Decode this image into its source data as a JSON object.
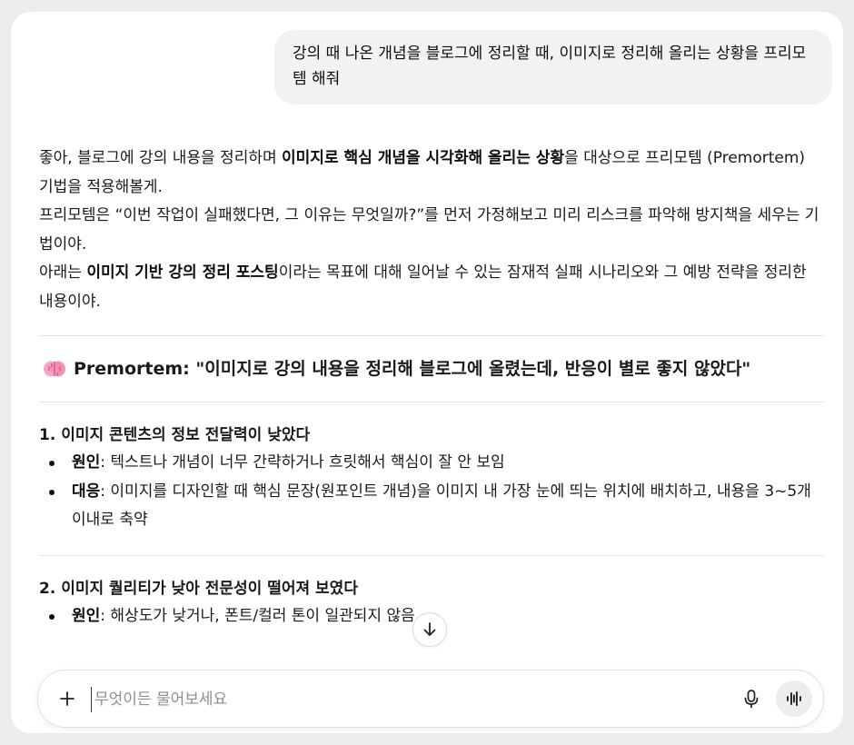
{
  "user_message": "강의 때 나온 개념을 블로그에 정리할 때, 이미지로 정리해 올리는 상황을 프리모템 해줘",
  "answer": {
    "intro": {
      "p1_a": "좋아, 블로그에 강의 내용을 정리하며 ",
      "p1_bold": "이미지로 핵심 개념을 시각화해 올리는 상황",
      "p1_b": "을 대상으로 프리모템 (Premortem) 기법을 적용해볼게.",
      "p2": "프리모템은 “이번 작업이 실패했다면, 그 이유는 무엇일까?”를 먼저 가정해보고 미리 리스크를 파악해 방지책을 세우는 기법이야.",
      "p3_a": "아래는 ",
      "p3_bold": "이미지 기반 강의 정리 포스팅",
      "p3_b": "이라는 목표에 대해 일어날 수 있는 잠재적 실패 시나리오와 그 예방 전략을 정리한 내용이야."
    },
    "premortem_title": "Premortem: \"이미지로 강의 내용을 정리해 블로그에 올렸는데, 반응이 별로 좋지 않았다\"",
    "sections": [
      {
        "title": "1. 이미지 콘텐츠의 정보 전달력이 낮았다",
        "bullets": [
          {
            "label": "원인",
            "text": ": 텍스트나 개념이 너무 간략하거나 흐릿해서 핵심이 잘 안 보임"
          },
          {
            "label": "대응",
            "text": ": 이미지를 디자인할 때 핵심 문장(원포인트 개념)을 이미지 내 가장 눈에 띄는 위치에 배치하고, 내용을 3~5개 이내로 축약"
          }
        ]
      },
      {
        "title": "2. 이미지 퀄리티가 낮아 전문성이 떨어져 보였다",
        "bullets": [
          {
            "label": "원인",
            "text": ": 해상도가 낮거나, 폰트/컬러 톤이 일관되지 않음"
          }
        ]
      }
    ]
  },
  "composer": {
    "placeholder": "무엇이든 물어보세요"
  },
  "icons": {
    "premortem": "brain-icon",
    "scroll": "arrow-down-icon",
    "attach": "plus-icon",
    "mic": "microphone-icon",
    "voice": "voice-waveform-icon"
  }
}
